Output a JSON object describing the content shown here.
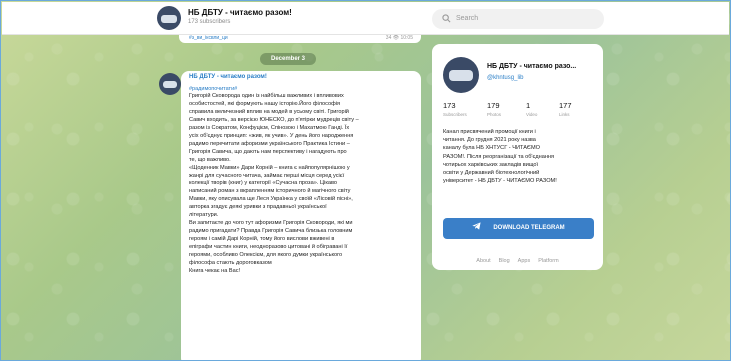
{
  "header": {
    "title": "НБ ДБТУ - читаємо разом!",
    "subscribers": "173 subscribers",
    "search_placeholder": "Search"
  },
  "feed": {
    "prev_message": {
      "link": "#з_ви_іксвли_ци",
      "meta": "34 👁 10:05"
    },
    "date_badge": "December 3",
    "message": {
      "author": "НБ ДБТУ - читаємо разом!",
      "tag": "#радимопочитати#",
      "lines": [
        "Григорій Сковорода один із найбільш важливих і впливових",
        "особистостей, які формують нашу історію.Його філософія",
        "справила величезний вплив на модей в усьому світі. Григорій",
        "Савич входить, за версією ЮНЕСКО, до п'ятірки мудреців світу –",
        "разом із Сократом, Конфуцієм, Спінозою і Махатмою Ганді. Їх",
        "усіх об'єднує принцип: «жив, як учив». У день його народження",
        "радимо перечитати афоризми українського Практика Істини –",
        "Григорія Савича, що дають нам перспективу і нагадують про",
        "те, що важливо.",
        "«Щоденник Мавки» Дари Корній – книга є найпопулярнішою у",
        "жанрі для сучасного читача, займає перші місця серед усієї",
        "колекції творів (книг) у категорії «Сучасна проза». Цікаво",
        "написаний роман з вкрапленням історичного й магічного світу",
        "Мавки, яку описувала ще Леся Українка у своїй «Лісовій пісні»,",
        "авторка згадує деякі уривки з прадавньої української",
        "літератури.",
        "Ви запитаєте до чого тут афоризми Григорія Сковороди, які ми",
        "радимо пригадати? Правда Григорія Савича близька головним",
        "героям і самій Дарі Корній, тому його вислови вживені в",
        "епіграфи частин книги, неодноразово цитовані й обігравані її",
        "героями, особливо Олексієм, для якого думки українського",
        "філософа стають дороговказом",
        "Книга чекає на Вас!"
      ]
    }
  },
  "card": {
    "name": "НБ ДБТУ - читаємо разо...",
    "handle": "@khntusg_lib",
    "stats": [
      {
        "value": "173",
        "label": "Subscribers"
      },
      {
        "value": "179",
        "label": "Photos"
      },
      {
        "value": "1",
        "label": "Video"
      },
      {
        "value": "177",
        "label": "Links"
      }
    ],
    "description": [
      "Канал присвячений промоції книги і",
      "читання. До грудня 2021 року назва",
      "каналу була НБ ХНТУСГ - ЧИТАЄМО",
      "РАЗОМ!. Після реорганізації та об'єднання",
      "чотирьох харківських закладів вищої",
      "освіти у Державний біотехнологічний",
      "університет - НБ ДБТУ - ЧИТАЄМО РАЗОМ!"
    ],
    "download_label": "DOWNLOAD TELEGRAM",
    "footer_links": [
      "About",
      "Blog",
      "Apps",
      "Platform"
    ]
  },
  "colors": {
    "accent": "#3a7fc8",
    "link": "#2b7fc7",
    "badge": "#6f8a5f"
  }
}
